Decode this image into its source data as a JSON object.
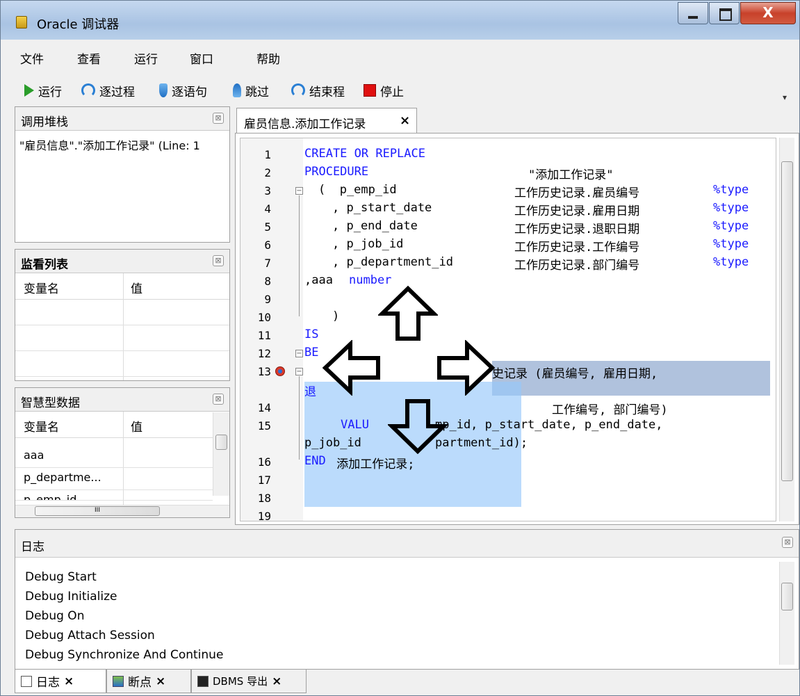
{
  "window": {
    "title": "Oracle 调试器",
    "close_label": "X"
  },
  "menu": [
    "文件",
    "查看",
    "运行",
    "窗口",
    "帮助"
  ],
  "toolbar": {
    "run": "运行",
    "step_over": "逐过程",
    "step_into": "逐语句",
    "step_out": "跳过",
    "finish": "结束程",
    "stop": "停止",
    "overflow": "▾"
  },
  "callstack": {
    "title": "调用堆栈",
    "line": "\"雇员信息\".\"添加工作记录\" (Line: 1"
  },
  "watch": {
    "title": "监看列表",
    "col_name": "变量名",
    "col_value": "值"
  },
  "smart": {
    "title": "智慧型数据",
    "col_name": "变量名",
    "col_value": "值",
    "rows": [
      "aaa",
      "p_departme...",
      "p_emp_id"
    ],
    "hscroll_label": "III"
  },
  "editor": {
    "tab_label": "雇员信息.添加工作记录",
    "tab_close": "×",
    "line_numbers": [
      "1",
      "2",
      "3",
      "4",
      "5",
      "6",
      "7",
      "8",
      "9",
      "10",
      "11",
      "12",
      "13",
      "14",
      "15",
      "16",
      "17",
      "18",
      "19"
    ],
    "code": {
      "l1": "CREATE OR REPLACE",
      "l2a": "PROCEDURE",
      "l2b": "\"添加工作记录\"",
      "l3a": "(  p_emp_id",
      "l3b": "工作历史记录.雇员编号",
      "l4a": ", p_start_date",
      "l4b": "工作历史记录.雇用日期",
      "l5a": ", p_end_date",
      "l5b": "工作历史记录.退职日期",
      "l6a": ", p_job_id",
      "l6b": "工作历史记录.工作编号",
      "l7a": ", p_department_id",
      "l7b": "工作历史记录.部门编号",
      "type": "%type",
      "l8a": ",aaa ",
      "l8b": "number",
      "l10": ")",
      "l11": "IS",
      "l12": "BE",
      "l13": "史记录 (雇员编号, 雇用日期,",
      "l13b": "退",
      "l14": "工作编号, 部门编号)",
      "l15a": "VALU",
      "l15b": "mp_id, p_start_date, p_end_date,",
      "l15c": "p_job_id",
      "l15d": "partment_id);",
      "l16a": "END",
      "l16b": " 添加工作记录;"
    }
  },
  "log": {
    "title": "日志",
    "lines": [
      "Debug Start",
      "Debug Initialize",
      "Debug On",
      "Debug Attach Session",
      "Debug Synchronize And Continue"
    ]
  },
  "bottom_tabs": [
    {
      "label": "日志",
      "close": "×"
    },
    {
      "label": "断点",
      "close": "×"
    },
    {
      "label": "DBMS 导出",
      "close": "×"
    }
  ]
}
